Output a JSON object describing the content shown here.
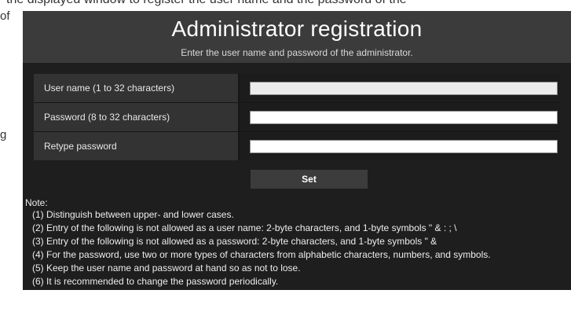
{
  "background": {
    "top_text": "the displayed window to register the user name and the password of the",
    "left_fragment_1": "of",
    "left_fragment_2": "g"
  },
  "dialog": {
    "title": "Administrator registration",
    "subtitle": "Enter the user name and password of the administrator.",
    "fields": [
      {
        "label": "User name (1 to 32 characters)",
        "value": ""
      },
      {
        "label": "Password (8 to 32 characters)",
        "value": ""
      },
      {
        "label": "Retype password",
        "value": ""
      }
    ],
    "set_label": "Set",
    "note_title": "Note:",
    "notes": [
      "(1) Distinguish between upper- and lower cases.",
      "(2) Entry of the following is not allowed as a user name:   2-byte characters, and 1-byte symbols \" & : ; \\",
      "(3) Entry of the following is not allowed as a password:   2-byte characters, and 1-byte symbols \" &",
      "(4) For the password, use two or more types of characters from alphabetic characters, numbers, and symbols.",
      "(5) Keep the user name and password at hand so as not to lose.",
      "(6) It is recommended to change the password periodically."
    ]
  },
  "colors": {
    "panel_background": "#1e1e1e",
    "header_background": "#3b3b3b",
    "label_cell_background": "#333333",
    "button_background": "#3c3c3c",
    "text": "#ffffff"
  }
}
